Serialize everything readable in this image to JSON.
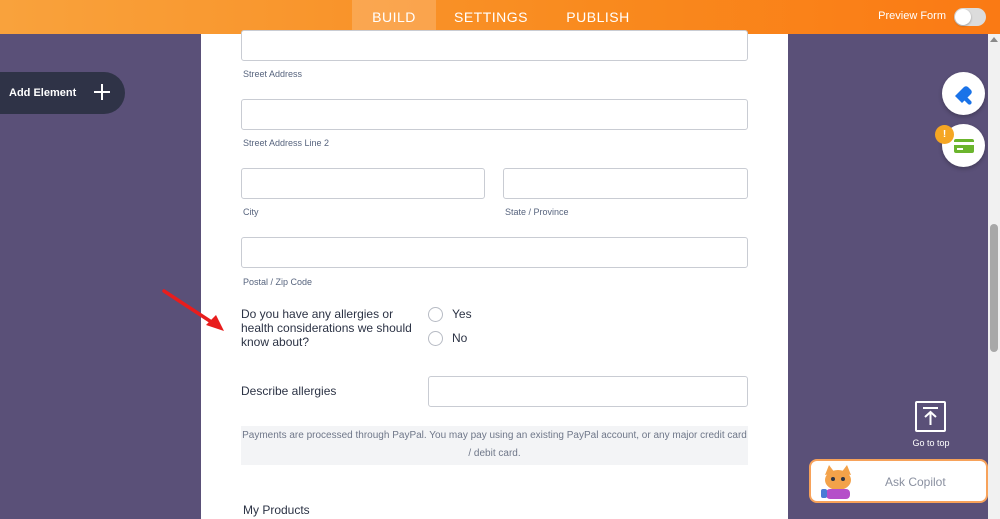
{
  "topbar": {
    "tabs": [
      {
        "label": "BUILD",
        "active": true
      },
      {
        "label": "SETTINGS",
        "active": false
      },
      {
        "label": "PUBLISH",
        "active": false
      }
    ],
    "preview_label": "Preview Form",
    "preview_on": false
  },
  "sidebar": {
    "add_element_label": "Add Element"
  },
  "form": {
    "street_address_label": "Street Address",
    "street_address_2_label": "Street Address Line 2",
    "city_label": "City",
    "state_label": "State / Province",
    "postal_label": "Postal / Zip Code",
    "allergy_question": "Do you have any allergies or health considerations we should know about?",
    "allergy_options": [
      "Yes",
      "No"
    ],
    "describe_label": "Describe allergies",
    "payment_note": "Payments are processed through PayPal.  You may pay using an existing PayPal account, or any major credit card / debit card.",
    "products_heading": "My Products"
  },
  "right_tools": {
    "warning_badge": "!",
    "go_to_top_label": "Go to top",
    "copilot_label": "Ask Copilot"
  },
  "colors": {
    "topbar": "#f98a1e",
    "canvas_bg": "#5a5078",
    "sidebar_button": "#2f3347",
    "accent_blue": "#1a73e8",
    "payment_green": "#6bb52d",
    "badge_orange": "#f5a623",
    "arrow_red": "#e81d1d"
  }
}
